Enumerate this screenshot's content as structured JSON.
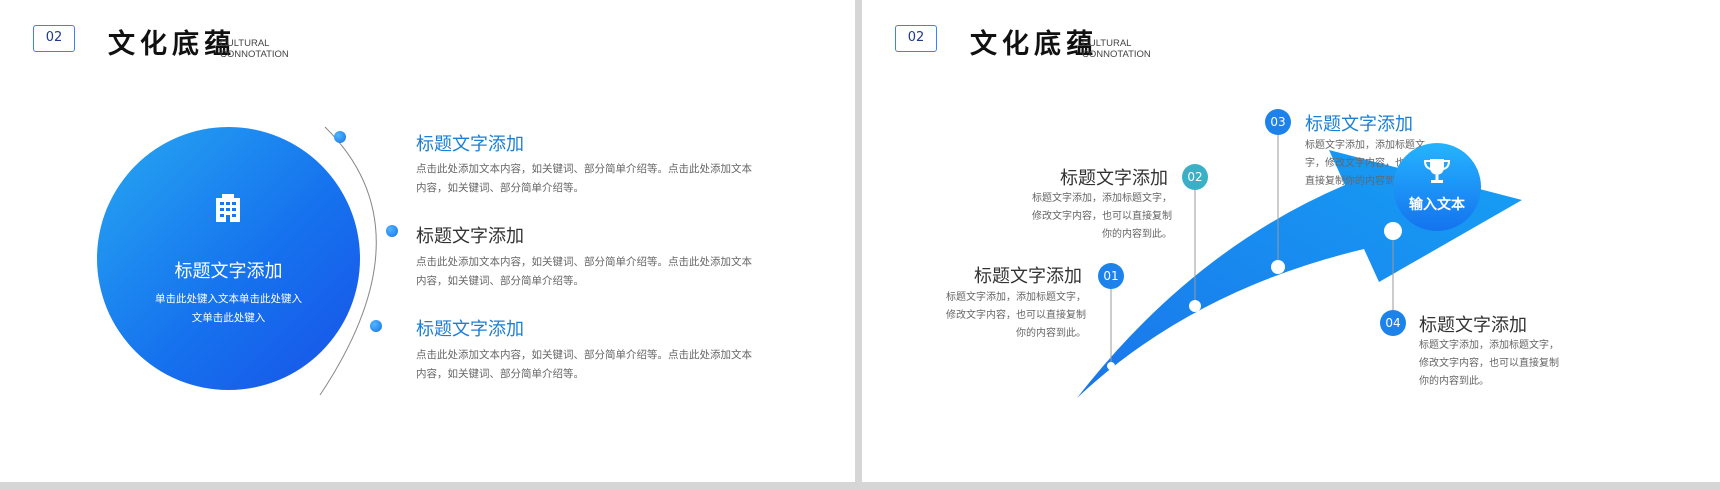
{
  "left": {
    "header": {
      "badge": "02",
      "title_cn": "文化底蕴",
      "title_en_1": "CULTURAL",
      "title_en_2": "CONNOTATION"
    },
    "circle": {
      "icon": "building-icon",
      "title": "标题文字添加",
      "sub_1": "单击此处键入文本单击此处键入",
      "sub_2": "文单击此处键入"
    },
    "items": [
      {
        "title": "标题文字添加",
        "desc_1": "点击此处添加文本内容，如关键词、部分简单介绍等。点击此处添加文本",
        "desc_2": "内容，如关键词、部分简单介绍等。"
      },
      {
        "title": "标题文字添加",
        "desc_1": "点击此处添加文本内容，如关键词、部分简单介绍等。点击此处添加文本",
        "desc_2": "内容，如关键词、部分简单介绍等。"
      },
      {
        "title": "标题文字添加",
        "desc_1": "点击此处添加文本内容，如关键词、部分简单介绍等。点击此处添加文本",
        "desc_2": "内容，如关键词、部分简单介绍等。"
      }
    ]
  },
  "right": {
    "header": {
      "badge": "02",
      "title_cn": "文化底蕴",
      "title_en_1": "CULTURAL",
      "title_en_2": "CONNOTATION"
    },
    "goal": {
      "icon": "trophy-icon",
      "label": "输入文本"
    },
    "steps": [
      {
        "num": "01",
        "title": "标题文字添加",
        "d1": "标题文字添加，添加标题文字，",
        "d2": "修改文字内容，也可以直接复制",
        "d3": "你的内容到此。"
      },
      {
        "num": "02",
        "title": "标题文字添加",
        "d1": "标题文字添加，添加标题文字，",
        "d2": "修改文字内容，也可以直接复制",
        "d3": "你的内容到此。"
      },
      {
        "num": "03",
        "title": "标题文字添加",
        "d1": "标题文字添加，添加标题文",
        "d2": "字，修改文字内容，也可以",
        "d3": "直接复制你的内容到此。"
      },
      {
        "num": "04",
        "title": "标题文字添加",
        "d1": "标题文字添加，添加标题文字，",
        "d2": "修改文字内容，也可以直接复制",
        "d3": "你的内容到此。"
      }
    ]
  },
  "colors": {
    "accent_blue": "#1a7fe8",
    "title_blue": "#1b7fd4",
    "title_dark": "#333333",
    "teal": "#3ab0c6"
  }
}
